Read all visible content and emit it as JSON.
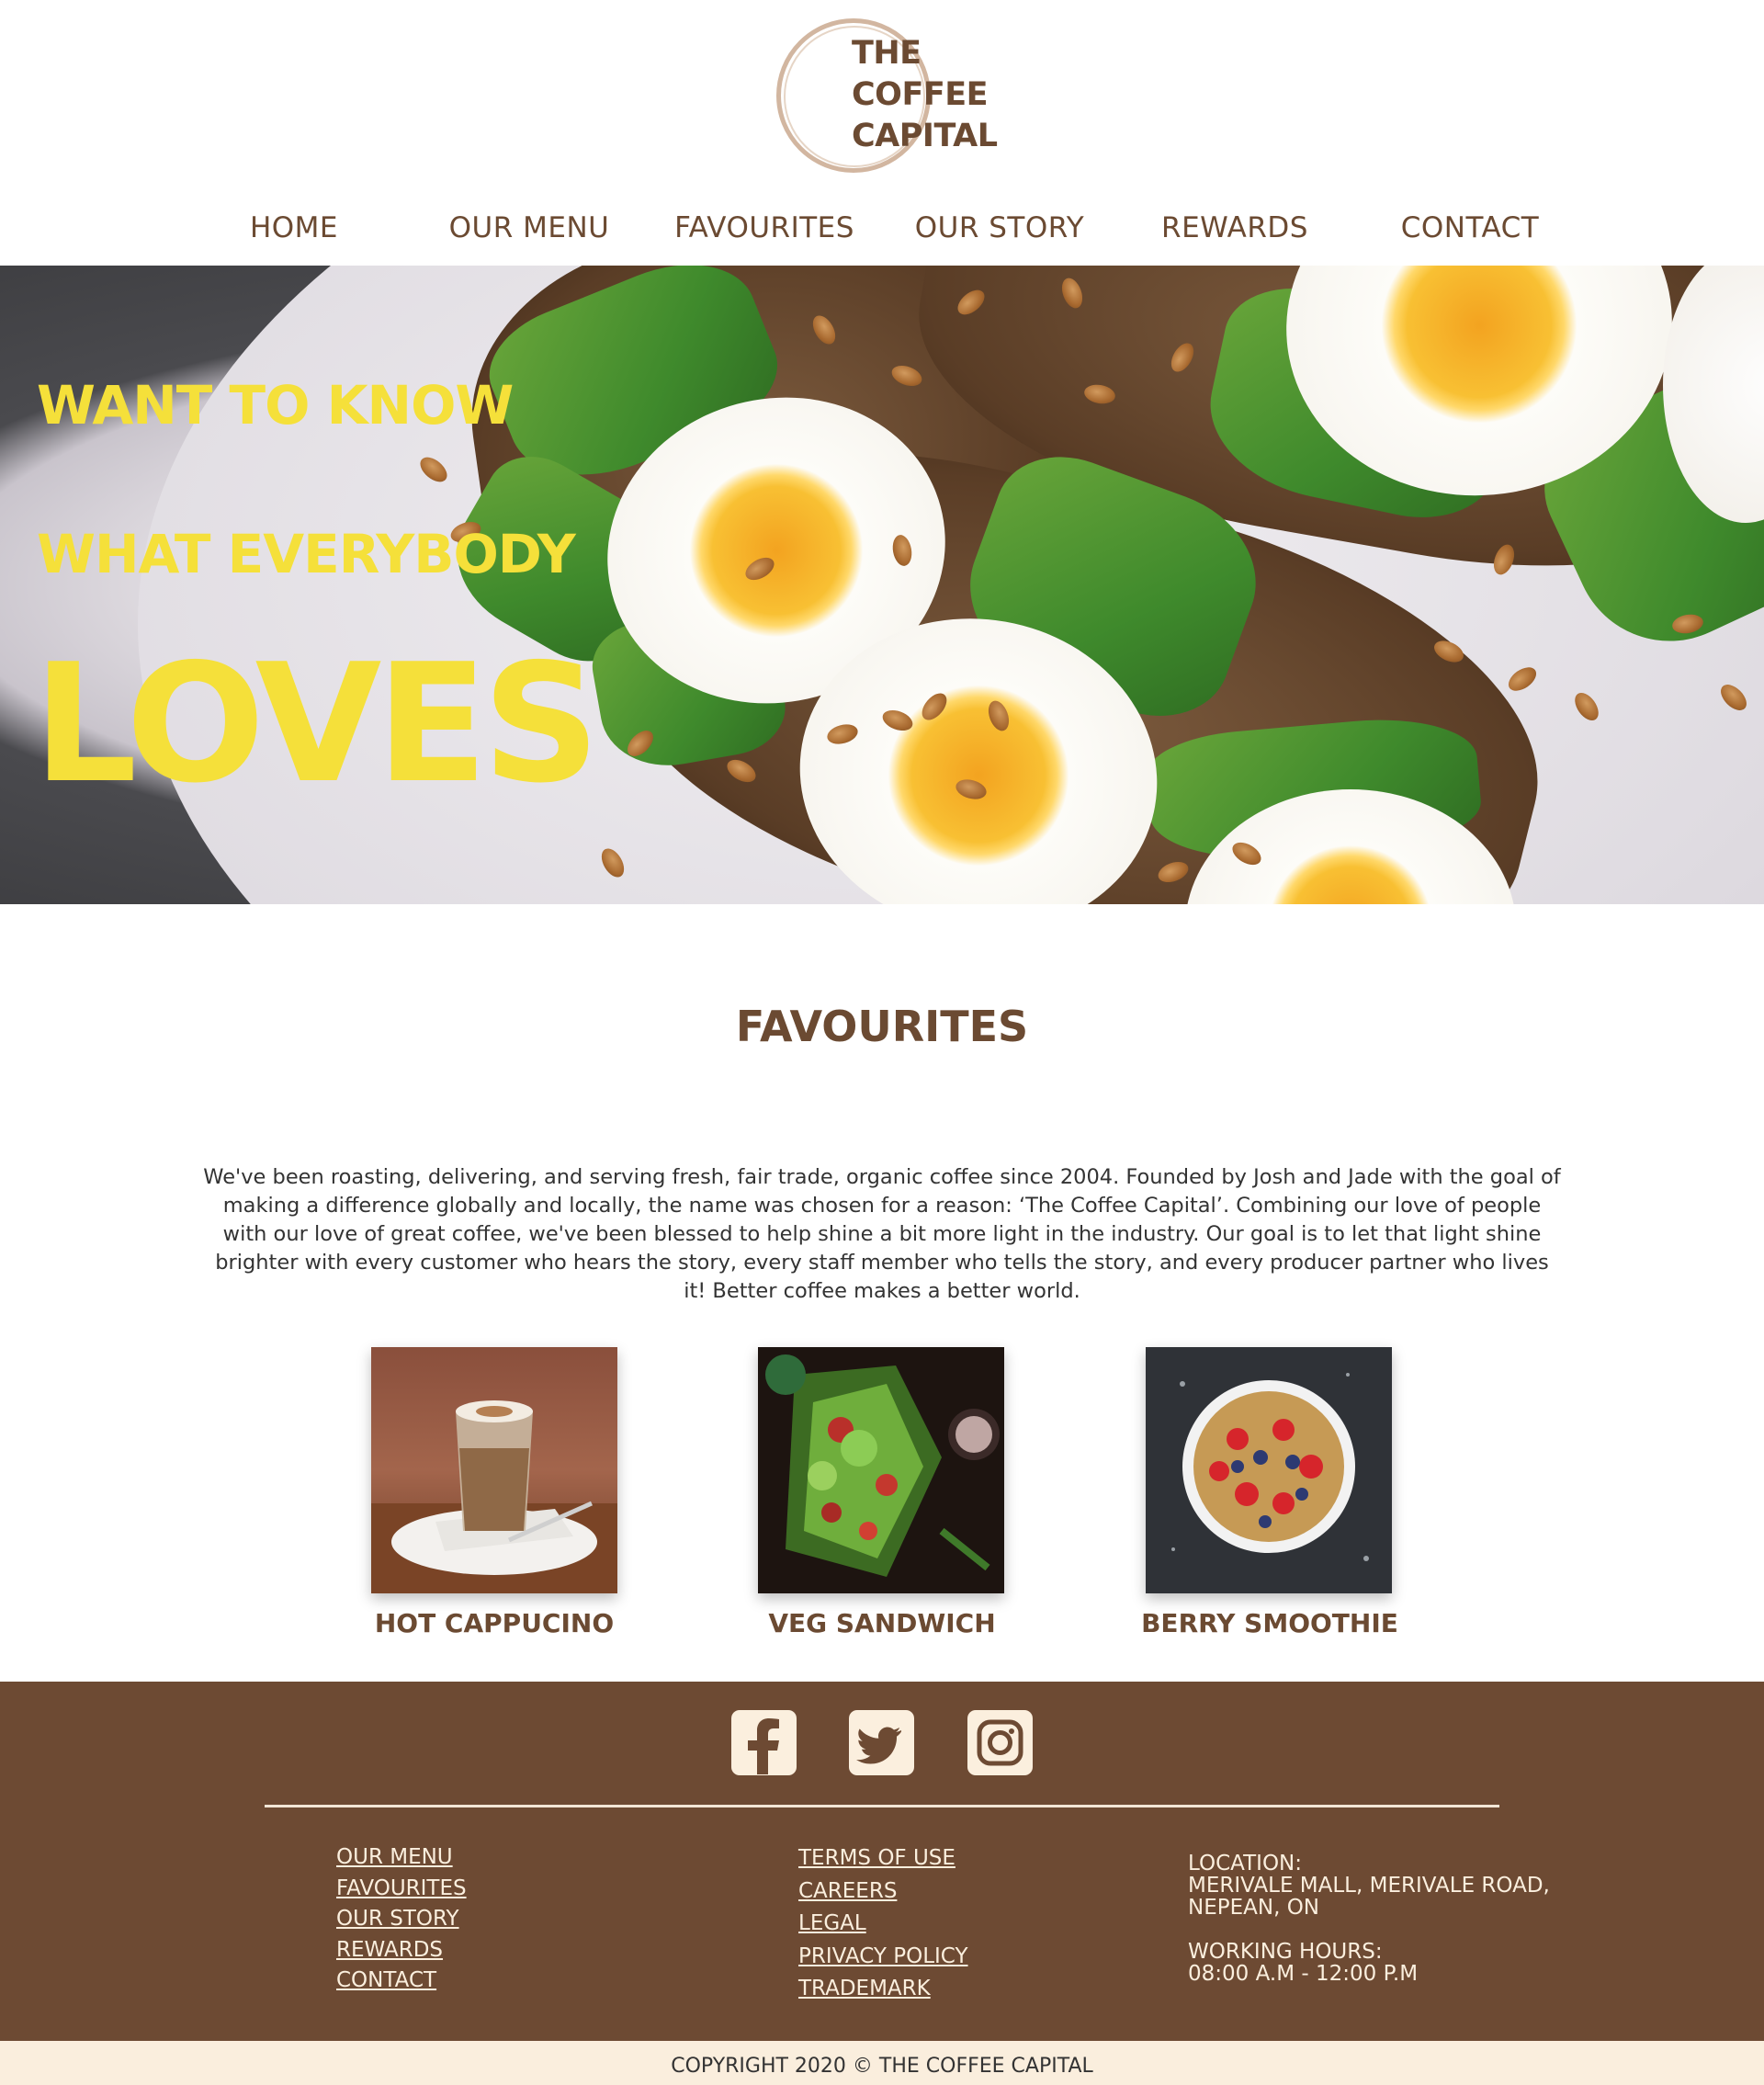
{
  "brand": {
    "logo_lines": [
      "THE",
      "COFFEE",
      "CAPITAL"
    ]
  },
  "nav": {
    "items": [
      "HOME",
      "OUR MENU",
      "FAVOURITES",
      "OUR STORY",
      "REWARDS",
      "CONTACT"
    ]
  },
  "hero": {
    "line1": "WANT TO KNOW",
    "line2": "WHAT EVERYBODY",
    "line3": "LOVES",
    "text_color": "#f5e03a"
  },
  "favourites": {
    "title": "FAVOURITES",
    "description": "We've been roasting, delivering, and serving fresh, fair trade, organic coffee since 2004. Founded by Josh and Jade with the goal of making a difference globally and locally, the name was chosen for a reason: ‘The Coffee Capital’. Combining our love of people with our love of great coffee, we've been blessed to help shine a bit more light in the industry. Our goal is to let that light shine brighter with every customer who hears the story, every staff member who tells the story, and every producer partner who lives it! Better coffee makes a better world.",
    "items": [
      {
        "label": "HOT CAPPUCINO",
        "image": "cappuccino-photo"
      },
      {
        "label": "VEG SANDWICH",
        "image": "veg-sandwich-photo"
      },
      {
        "label": "BERRY SMOOTHIE",
        "image": "berry-bowl-photo"
      }
    ]
  },
  "footer": {
    "social": [
      "facebook-icon",
      "twitter-icon",
      "instagram-icon"
    ],
    "links_col1": [
      "OUR MENU",
      "FAVOURITES",
      "OUR STORY",
      "REWARDS",
      "CONTACT"
    ],
    "links_col2": [
      "TERMS OF USE",
      "CAREERS",
      "LEGAL",
      "PRIVACY POLICY",
      "TRADEMARK"
    ],
    "location_label": "LOCATION:",
    "location_line1": "MERIVALE MALL, MERIVALE ROAD,",
    "location_line2": "NEPEAN, ON",
    "hours_label": "WORKING HOURS:",
    "hours_value": "08:00 A.M - 12:00 P.M",
    "copyright": "COPYRIGHT 2020 © THE COFFEE CAPITAL"
  },
  "colors": {
    "brand_brown": "#6b4a32",
    "footer_bg": "#6d4a33",
    "footer_text": "#fbefde",
    "copyright_bg": "#faeedd"
  }
}
